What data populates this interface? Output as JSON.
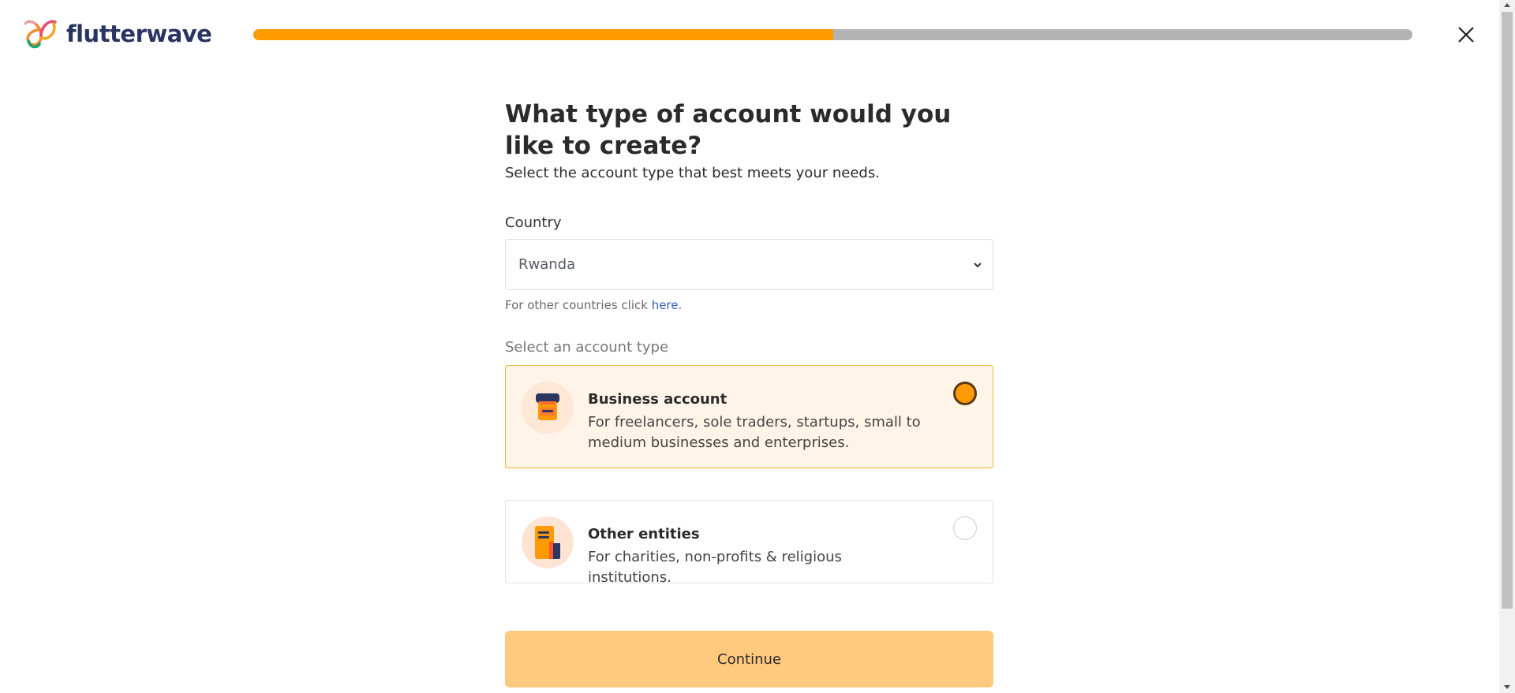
{
  "header": {
    "brand_name": "flutterwave",
    "progress_fraction": 0.5,
    "close_icon": "close-icon"
  },
  "main": {
    "title": "What type of account would you like to create?",
    "subtitle": "Select the account type that best meets your needs.",
    "country": {
      "label": "Country",
      "value": "Rwanda"
    },
    "hint": {
      "text": "For other countries click ",
      "link": "here",
      "suffix": "."
    },
    "account_type_label": "Select an account type",
    "account_types": [
      {
        "title": "Business account",
        "description": "For freelancers, sole traders, startups, small to medium businesses and enterprises.",
        "selected": true,
        "icon": "shop-icon"
      },
      {
        "title": "Other entities",
        "description": "For charities, non-profits & religious institutions.",
        "selected": false,
        "icon": "building-icon"
      }
    ],
    "continue_label": "Continue"
  },
  "colors": {
    "accent": "#ff9b00",
    "progress_track": "#b3b3b3",
    "brand_text": "#2a3362",
    "selected_card_bg": "#fff4e8",
    "selected_card_border": "#f3b533",
    "continue_bg": "#ffc97e",
    "link": "#3b5fc0"
  }
}
